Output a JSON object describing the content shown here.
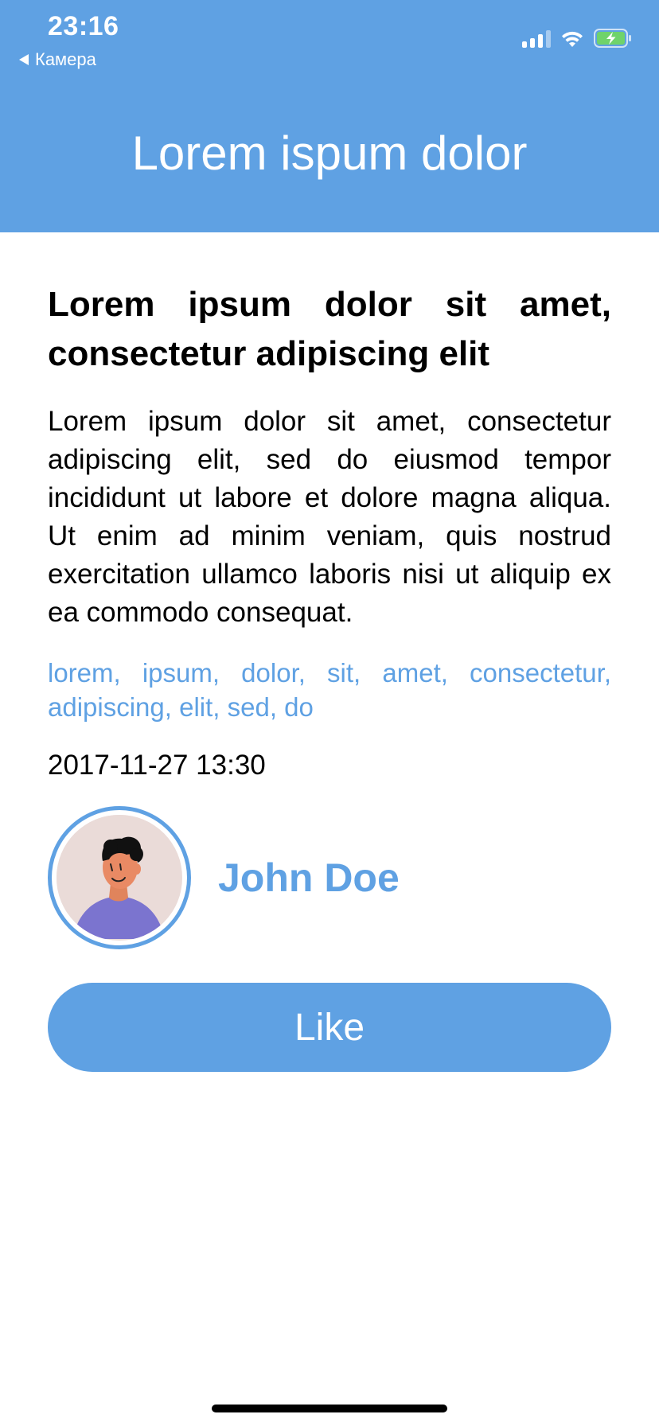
{
  "status_bar": {
    "time": "23:16",
    "back_label": "Камера"
  },
  "nav": {
    "title": "Lorem ispum dolor"
  },
  "article": {
    "title": "Lorem ipsum dolor sit amet, consectetur adipiscing elit",
    "body": "Lorem ipsum dolor sit amet, consectetur adipiscing elit, sed do eiusmod tempor incididunt ut labore et dolore magna aliqua. Ut enim ad minim veniam, quis nostrud exercitation ullamco laboris nisi ut aliquip ex ea commodo consequat.",
    "tags": "lorem, ipsum, dolor, sit, amet, consectetur, adipiscing, elit, sed, do",
    "timestamp": "2017-11-27 13:30"
  },
  "author": {
    "name": "John Doe"
  },
  "actions": {
    "like_label": "Like"
  },
  "colors": {
    "accent": "#5fa1e3",
    "background": "#ffffff",
    "text": "#000000"
  },
  "icons": [
    "back-arrow-icon",
    "cellular-signal-icon",
    "wifi-icon",
    "battery-charging-icon",
    "avatar-illustration"
  ]
}
